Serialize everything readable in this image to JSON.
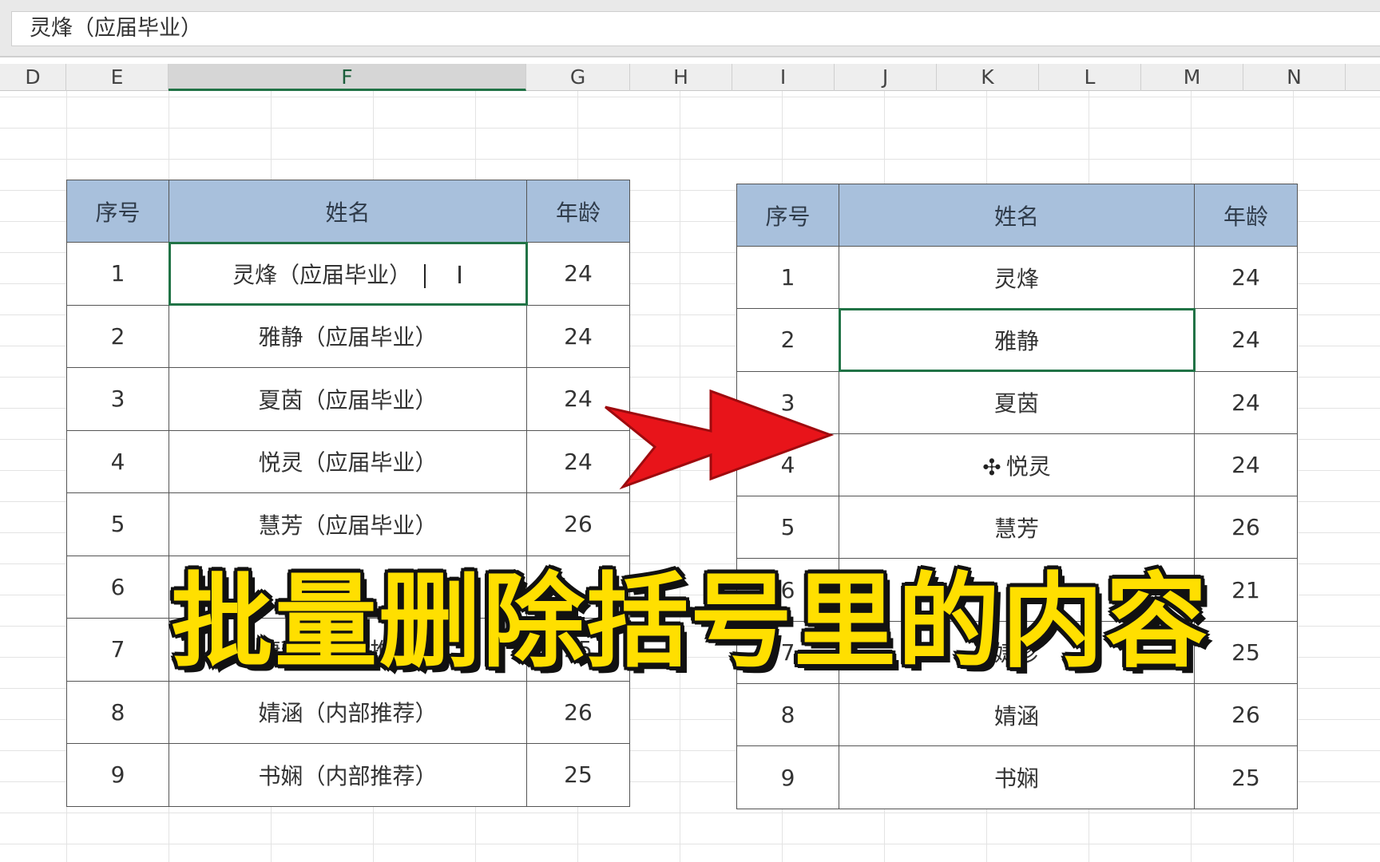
{
  "formula_bar": {
    "value": "灵烽（应届毕业）"
  },
  "column_headers": [
    {
      "letter": "D",
      "active": false
    },
    {
      "letter": "E",
      "active": false
    },
    {
      "letter": "F",
      "active": true
    },
    {
      "letter": "G",
      "active": false
    },
    {
      "letter": "H",
      "active": false
    },
    {
      "letter": "I",
      "active": false
    },
    {
      "letter": "J",
      "active": false
    },
    {
      "letter": "K",
      "active": false
    },
    {
      "letter": "L",
      "active": false
    },
    {
      "letter": "M",
      "active": false
    },
    {
      "letter": "N",
      "active": false
    }
  ],
  "table_before": {
    "headers": [
      "序号",
      "姓名",
      "年龄"
    ],
    "rows": [
      [
        "1",
        "灵烽（应届毕业）",
        "24"
      ],
      [
        "2",
        "雅静（应届毕业）",
        "24"
      ],
      [
        "3",
        "夏茵（应届毕业）",
        "24"
      ],
      [
        "4",
        "悦灵（应届毕业）",
        "24"
      ],
      [
        "5",
        "慧芳（应届毕业）",
        "26"
      ],
      [
        "6",
        "",
        ""
      ],
      [
        "7",
        "婕珍（内部推荐）",
        "25"
      ],
      [
        "8",
        "婧涵（内部推荐）",
        "26"
      ],
      [
        "9",
        "书娴（内部推荐）",
        "25"
      ]
    ],
    "selected_row": 0
  },
  "table_after": {
    "headers": [
      "序号",
      "姓名",
      "年龄"
    ],
    "rows": [
      [
        "1",
        "灵烽",
        "24"
      ],
      [
        "2",
        "雅静",
        "24"
      ],
      [
        "3",
        "夏茵",
        "24"
      ],
      [
        "4",
        "悦灵",
        "24"
      ],
      [
        "5",
        "慧芳",
        "26"
      ],
      [
        "6",
        "",
        "21"
      ],
      [
        "7",
        "婕珍",
        "25"
      ],
      [
        "8",
        "婧涵",
        "26"
      ],
      [
        "9",
        "书娴",
        "25"
      ]
    ],
    "selected_row": 1
  },
  "overlay": {
    "caption": "批量删除括号里的内容"
  },
  "colors": {
    "header_fill": "#a8c0dc",
    "selection": "#217346",
    "arrow": "#e8141a",
    "caption": "#ffdf00"
  },
  "icons": {
    "edit_cursor": "text-ibeam-icon",
    "move_cursor": "move-cross-icon",
    "arrow": "red-right-arrow-icon"
  }
}
